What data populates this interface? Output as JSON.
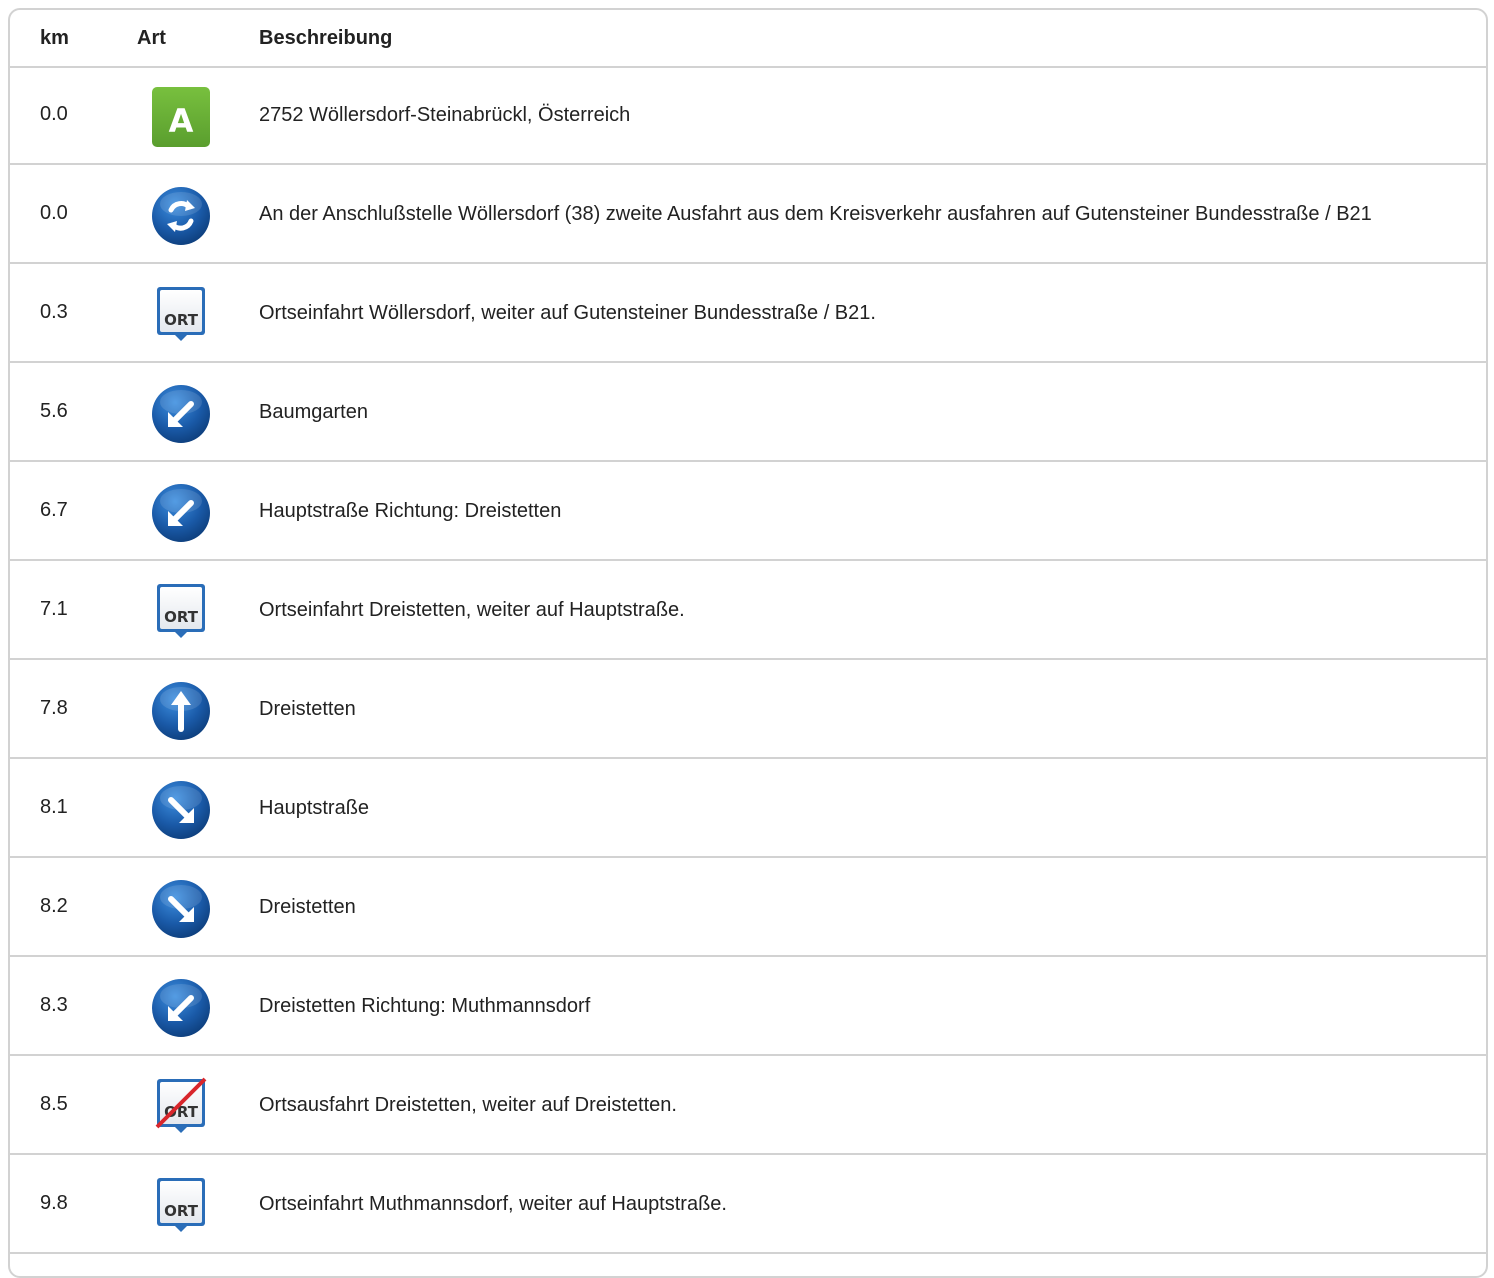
{
  "table": {
    "headers": {
      "km": "km",
      "art": "Art",
      "desc": "Beschreibung"
    },
    "rows": [
      {
        "km": "0.0",
        "icon": "start-a-icon",
        "text": "2752 Wöllersdorf-Steinabrückl, Österreich"
      },
      {
        "km": "0.0",
        "icon": "roundabout-icon",
        "text": "An der Anschlußstelle Wöllersdorf (38) zweite Ausfahrt aus dem Kreisverkehr ausfahren auf Gutensteiner Bundesstraße / B21"
      },
      {
        "km": "0.3",
        "icon": "town-entry-icon",
        "icon_text": "ORT",
        "text": "Ortseinfahrt Wöllersdorf, weiter auf Gutensteiner Bundesstraße / B21."
      },
      {
        "km": "5.6",
        "icon": "turn-left-icon",
        "text": "Baumgarten"
      },
      {
        "km": "6.7",
        "icon": "turn-left-icon",
        "text": "Hauptstraße Richtung: Dreistetten"
      },
      {
        "km": "7.1",
        "icon": "town-entry-icon",
        "icon_text": "ORT",
        "text": "Ortseinfahrt Dreistetten, weiter auf Hauptstraße."
      },
      {
        "km": "7.8",
        "icon": "straight-icon",
        "text": "Dreistetten"
      },
      {
        "km": "8.1",
        "icon": "turn-right-icon",
        "text": "Hauptstraße"
      },
      {
        "km": "8.2",
        "icon": "turn-right-icon",
        "text": "Dreistetten"
      },
      {
        "km": "8.3",
        "icon": "turn-left-icon",
        "text": "Dreistetten Richtung: Muthmannsdorf"
      },
      {
        "km": "8.5",
        "icon": "town-exit-icon",
        "icon_text": "ORT",
        "text": "Ortsausfahrt Dreistetten, weiter auf Dreistetten."
      },
      {
        "km": "9.8",
        "icon": "town-entry-icon",
        "icon_text": "ORT",
        "text": "Ortseinfahrt Muthmannsdorf, weiter auf Hauptstraße."
      }
    ]
  },
  "start_marker_letter": "A",
  "colors": {
    "start_green": "#5a9e2e",
    "maneuver_blue": "#1a5aa8",
    "town_sign_blue": "#2a6db8",
    "exit_red": "#d8262c",
    "border": "#d2d2d2"
  }
}
